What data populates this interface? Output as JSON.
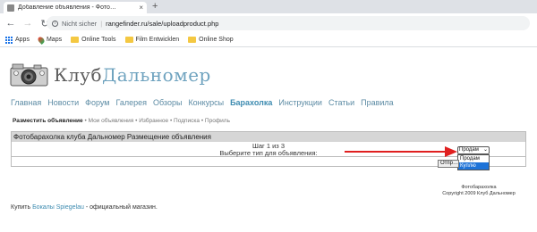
{
  "browser": {
    "tab_title": "Добавление объявления - Фото…",
    "tab_close": "×",
    "new_tab": "+",
    "security_label": "Nicht sicher",
    "separator": "|",
    "url": "rangefinder.ru/sale/uploadproduct.php",
    "bookmarks": [
      {
        "label": "Apps",
        "icon": "apps-icon"
      },
      {
        "label": "Maps",
        "icon": "maps-icon"
      },
      {
        "label": "Online Tools",
        "icon": "folder-icon"
      },
      {
        "label": "Film Entwicklen",
        "icon": "folder-icon"
      },
      {
        "label": "Online Shop",
        "icon": "folder-icon"
      }
    ]
  },
  "site": {
    "logo_main": "Клуб",
    "logo_accent": "Дальномер",
    "nav": [
      "Главная",
      "Новости",
      "Форум",
      "Галерея",
      "Обзоры",
      "Конкурсы",
      "Барахолка",
      "Инструкции",
      "Статьи",
      "Правила"
    ],
    "nav_active_index": 6,
    "subnav": {
      "current": "Разместить объявление",
      "items": [
        "Мои объявления",
        "Избранное",
        "Подписка",
        "Профиль"
      ],
      "separator": "•"
    }
  },
  "form": {
    "header": "Фотобарахолка клуба Дальномер Размещение объявления",
    "step": "Шаг 1 из 3",
    "prompt": "Выберите тип для объявления:",
    "select_value": "Продам",
    "options": [
      "Продам",
      "Куплю"
    ],
    "highlighted_option_index": 1,
    "submit_label": "Отпр…"
  },
  "footer": {
    "brand_line1": "Фотобарахолка",
    "brand_line2": "Copyright 2009 Клуб Дальномер",
    "shop_prefix": "Купить ",
    "shop_link": "Бокалы Spiegelau",
    "shop_suffix": " - официальный магазин."
  },
  "colors": {
    "link": "#5c8ba4",
    "accent": "#6fa3bf",
    "arrow": "#e02020",
    "highlight": "#1e73d8"
  }
}
